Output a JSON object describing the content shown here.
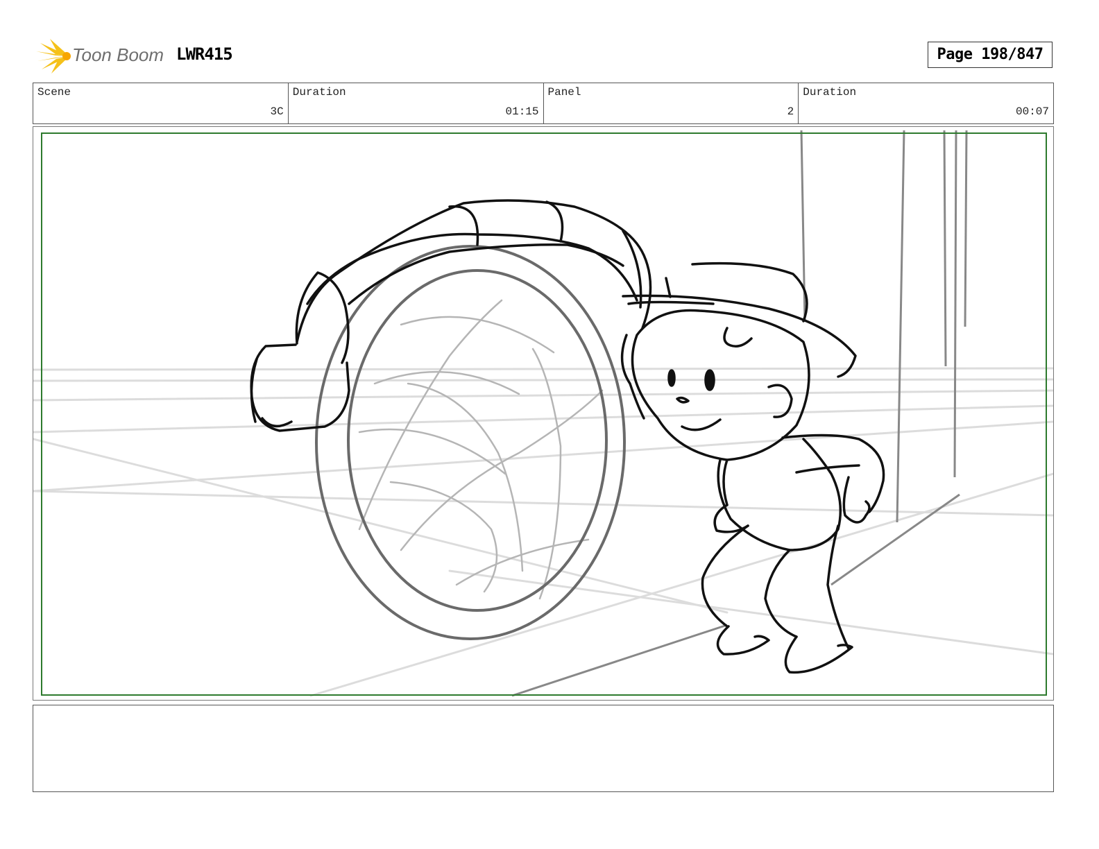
{
  "header": {
    "brand": "Toon Boom",
    "project": "LWR415",
    "page_label": "Page 198/847"
  },
  "info": {
    "scene_label": "Scene",
    "scene_value": "3C",
    "scene_duration_label": "Duration",
    "scene_duration_value": "01:15",
    "panel_label": "Panel",
    "panel_value": "2",
    "panel_duration_label": "Duration",
    "panel_duration_value": "00:07"
  },
  "colors": {
    "logo_yellow": "#f5c11a",
    "frame_green": "#2d7a2d"
  },
  "notes": {
    "text": ""
  }
}
